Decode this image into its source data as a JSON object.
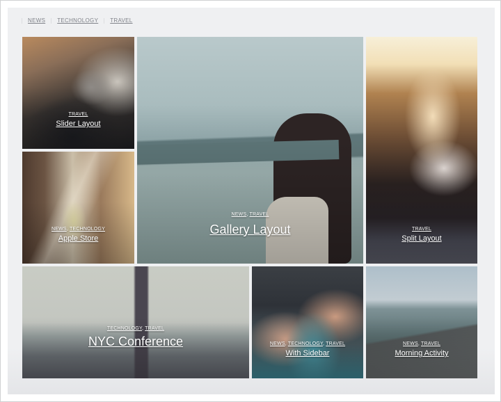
{
  "filters": [
    {
      "label": "NEWS"
    },
    {
      "label": "TECHNOLOGY"
    },
    {
      "label": "TRAVEL"
    }
  ],
  "tiles": [
    {
      "title": "Slider Layout",
      "categories": [
        "TRAVEL"
      ]
    },
    {
      "title": "Apple Store",
      "categories": [
        "NEWS",
        "TECHNOLOGY"
      ]
    },
    {
      "title": "Gallery Layout",
      "categories": [
        "NEWS",
        "TRAVEL"
      ]
    },
    {
      "title": "Split Layout",
      "categories": [
        "TRAVEL"
      ]
    },
    {
      "title": "NYC Conference",
      "categories": [
        "TECHNOLOGY",
        "TRAVEL"
      ]
    },
    {
      "title": "With Sidebar",
      "categories": [
        "NEWS",
        "TECHNOLOGY",
        "TRAVEL"
      ]
    },
    {
      "title": "Morning Activity",
      "categories": [
        "NEWS",
        "TRAVEL"
      ]
    }
  ],
  "colors": {
    "panel_bg": "#eff0f2",
    "filter_text": "#80838a",
    "caption_text": "#ffffff"
  }
}
